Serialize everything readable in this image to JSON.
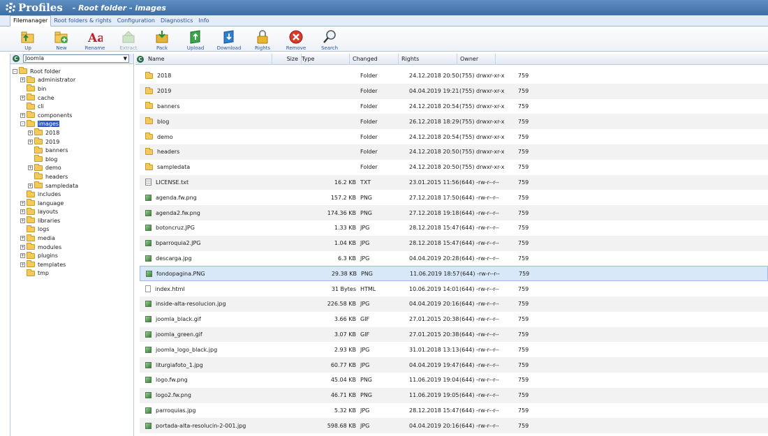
{
  "app": {
    "logo_text": "Profiles",
    "window_title": "- Root folder - images"
  },
  "tabs": [
    {
      "label": "Filemanager",
      "active": true
    },
    {
      "label": "Root folders & rights",
      "active": false
    },
    {
      "label": "Configuration",
      "active": false
    },
    {
      "label": "Diagnostics",
      "active": false
    },
    {
      "label": "Info",
      "active": false
    }
  ],
  "toolbar": {
    "up": "Up",
    "new": "New",
    "rename": "Rename",
    "extract": "Extract",
    "pack": "Pack",
    "upload": "Upload",
    "download": "Download",
    "rights": "Rights",
    "remove": "Remove",
    "search": "Search"
  },
  "site_select": {
    "value": "Joomla"
  },
  "tree": [
    {
      "label": "Root folder",
      "level": 0,
      "toggle": "-"
    },
    {
      "label": "administrator",
      "level": 1,
      "toggle": "+"
    },
    {
      "label": "bin",
      "level": 1,
      "toggle": ""
    },
    {
      "label": "cache",
      "level": 1,
      "toggle": "+"
    },
    {
      "label": "cli",
      "level": 1,
      "toggle": ""
    },
    {
      "label": "components",
      "level": 1,
      "toggle": "+"
    },
    {
      "label": "images",
      "level": 1,
      "toggle": "-",
      "selected": true
    },
    {
      "label": "2018",
      "level": 2,
      "toggle": "+"
    },
    {
      "label": "2019",
      "level": 2,
      "toggle": "+"
    },
    {
      "label": "banners",
      "level": 2,
      "toggle": ""
    },
    {
      "label": "blog",
      "level": 2,
      "toggle": ""
    },
    {
      "label": "demo",
      "level": 2,
      "toggle": "+"
    },
    {
      "label": "headers",
      "level": 2,
      "toggle": ""
    },
    {
      "label": "sampledata",
      "level": 2,
      "toggle": "+"
    },
    {
      "label": "includes",
      "level": 1,
      "toggle": ""
    },
    {
      "label": "language",
      "level": 1,
      "toggle": "+"
    },
    {
      "label": "layouts",
      "level": 1,
      "toggle": "+"
    },
    {
      "label": "libraries",
      "level": 1,
      "toggle": "+"
    },
    {
      "label": "logs",
      "level": 1,
      "toggle": ""
    },
    {
      "label": "media",
      "level": 1,
      "toggle": "+"
    },
    {
      "label": "modules",
      "level": 1,
      "toggle": "+"
    },
    {
      "label": "plugins",
      "level": 1,
      "toggle": "+"
    },
    {
      "label": "templates",
      "level": 1,
      "toggle": "+"
    },
    {
      "label": "tmp",
      "level": 1,
      "toggle": ""
    }
  ],
  "columns": {
    "name": "Name",
    "size": "Size",
    "type": "Type",
    "changed": "Changed",
    "rights": "Rights",
    "owner": "Owner"
  },
  "files": [
    {
      "name": "2018",
      "size": "",
      "type": "Folder",
      "changed": "24.12.2018 20:50",
      "rights": "(755) drwxr-xr-x",
      "owner": "759",
      "icon": "folder"
    },
    {
      "name": "2019",
      "size": "",
      "type": "Folder",
      "changed": "04.04.2019 19:21",
      "rights": "(755) drwxr-xr-x",
      "owner": "759",
      "icon": "folder"
    },
    {
      "name": "banners",
      "size": "",
      "type": "Folder",
      "changed": "24.12.2018 20:54",
      "rights": "(755) drwxr-xr-x",
      "owner": "759",
      "icon": "folder"
    },
    {
      "name": "blog",
      "size": "",
      "type": "Folder",
      "changed": "26.12.2018 18:29",
      "rights": "(755) drwxr-xr-x",
      "owner": "759",
      "icon": "folder"
    },
    {
      "name": "demo",
      "size": "",
      "type": "Folder",
      "changed": "24.12.2018 20:54",
      "rights": "(755) drwxr-xr-x",
      "owner": "759",
      "icon": "folder"
    },
    {
      "name": "headers",
      "size": "",
      "type": "Folder",
      "changed": "24.12.2018 20:50",
      "rights": "(755) drwxr-xr-x",
      "owner": "759",
      "icon": "folder"
    },
    {
      "name": "sampledata",
      "size": "",
      "type": "Folder",
      "changed": "24.12.2018 20:50",
      "rights": "(755) drwxr-xr-x",
      "owner": "759",
      "icon": "folder"
    },
    {
      "name": "LICENSE.txt",
      "size": "16.2 KB",
      "type": "TXT",
      "changed": "23.01.2015 11:56",
      "rights": "(644) -rw-r--r--",
      "owner": "759",
      "icon": "txt"
    },
    {
      "name": "agenda.fw.png",
      "size": "157.2 KB",
      "type": "PNG",
      "changed": "27.12.2018 17:50",
      "rights": "(644) -rw-r--r--",
      "owner": "759",
      "icon": "image"
    },
    {
      "name": "agenda2.fw.png",
      "size": "174.36 KB",
      "type": "PNG",
      "changed": "27.12.2018 19:18",
      "rights": "(644) -rw-r--r--",
      "owner": "759",
      "icon": "image"
    },
    {
      "name": "botoncruz.JPG",
      "size": "1.33 KB",
      "type": "JPG",
      "changed": "28.12.2018 15:47",
      "rights": "(644) -rw-r--r--",
      "owner": "759",
      "icon": "image"
    },
    {
      "name": "bparroquia2.JPG",
      "size": "1.04 KB",
      "type": "JPG",
      "changed": "28.12.2018 15:47",
      "rights": "(644) -rw-r--r--",
      "owner": "759",
      "icon": "image"
    },
    {
      "name": "descarga.jpg",
      "size": "6.3 KB",
      "type": "JPG",
      "changed": "04.04.2019 20:28",
      "rights": "(644) -rw-r--r--",
      "owner": "759",
      "icon": "image"
    },
    {
      "name": "fondopagina.PNG",
      "size": "29.38 KB",
      "type": "PNG",
      "changed": "11.06.2019 18:57",
      "rights": "(644) -rw-r--r--",
      "owner": "759",
      "icon": "image",
      "selected": true
    },
    {
      "name": "index.html",
      "size": "31 Bytes",
      "type": "HTML",
      "changed": "10.06.2019 14:01",
      "rights": "(644) -rw-r--r--",
      "owner": "759",
      "icon": "html"
    },
    {
      "name": "inside-alta-resolucion.jpg",
      "size": "226.58 KB",
      "type": "JPG",
      "changed": "04.04.2019 20:16",
      "rights": "(644) -rw-r--r--",
      "owner": "759",
      "icon": "image"
    },
    {
      "name": "joomla_black.gif",
      "size": "3.66 KB",
      "type": "GIF",
      "changed": "27.01.2015 20:38",
      "rights": "(644) -rw-r--r--",
      "owner": "759",
      "icon": "image"
    },
    {
      "name": "joomla_green.gif",
      "size": "3.07 KB",
      "type": "GIF",
      "changed": "27.01.2015 20:38",
      "rights": "(644) -rw-r--r--",
      "owner": "759",
      "icon": "image"
    },
    {
      "name": "joomla_logo_black.jpg",
      "size": "2.93 KB",
      "type": "JPG",
      "changed": "31.01.2018 13:13",
      "rights": "(644) -rw-r--r--",
      "owner": "759",
      "icon": "image"
    },
    {
      "name": "liturgiafoto_1.jpg",
      "size": "60.77 KB",
      "type": "JPG",
      "changed": "04.04.2019 19:47",
      "rights": "(644) -rw-r--r--",
      "owner": "759",
      "icon": "image"
    },
    {
      "name": "logo.fw.png",
      "size": "45.04 KB",
      "type": "PNG",
      "changed": "11.06.2019 19:04",
      "rights": "(644) -rw-r--r--",
      "owner": "759",
      "icon": "image"
    },
    {
      "name": "logo2.fw.png",
      "size": "46.71 KB",
      "type": "PNG",
      "changed": "11.06.2019 19:05",
      "rights": "(644) -rw-r--r--",
      "owner": "759",
      "icon": "image"
    },
    {
      "name": "parroquias.jpg",
      "size": "5.32 KB",
      "type": "JPG",
      "changed": "28.12.2018 15:47",
      "rights": "(644) -rw-r--r--",
      "owner": "759",
      "icon": "image"
    },
    {
      "name": "portada-alta-resolucin-2-001.jpg",
      "size": "598.68 KB",
      "type": "JPG",
      "changed": "04.04.2019 20:16",
      "rights": "(644) -rw-r--r--",
      "owner": "759",
      "icon": "image"
    }
  ]
}
